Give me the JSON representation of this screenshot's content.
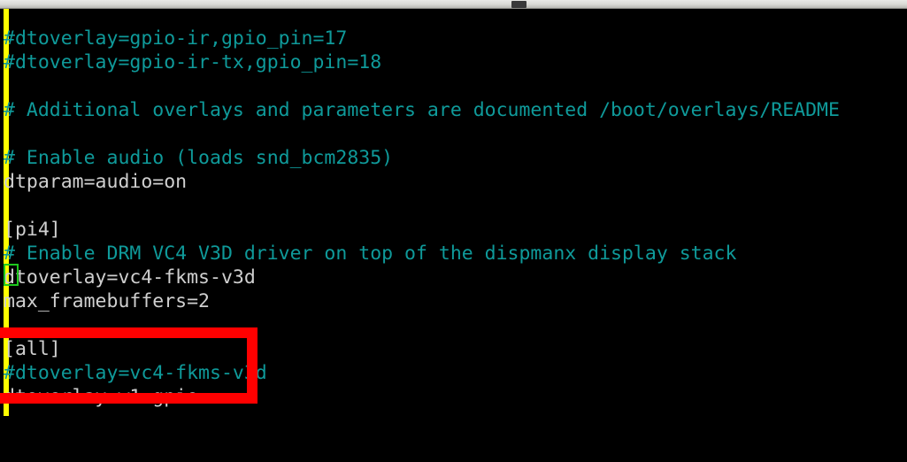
{
  "window": {
    "toolbar_present": true
  },
  "terminal": {
    "background_color": "#000000",
    "comment_color": "#0f9a9a",
    "text_color": "#cfcfcf",
    "left_marker_color": "#ffff00",
    "cursor_color": "#1ec81e",
    "cursor_line_index": 11,
    "lines": [
      {
        "text": "#dtoverlay=gpio-ir,gpio_pin=17",
        "type": "comment"
      },
      {
        "text": "#dtoverlay=gpio-ir-tx,gpio_pin=18",
        "type": "comment"
      },
      {
        "text": "",
        "type": "blank"
      },
      {
        "text": "# Additional overlays and parameters are documented /boot/overlays/README",
        "type": "comment"
      },
      {
        "text": "",
        "type": "blank"
      },
      {
        "text": "# Enable audio (loads snd_bcm2835)",
        "type": "comment"
      },
      {
        "text": "dtparam=audio=on",
        "type": "conf"
      },
      {
        "text": "",
        "type": "blank"
      },
      {
        "text": "[pi4]",
        "type": "conf"
      },
      {
        "text": "# Enable DRM VC4 V3D driver on top of the dispmanx display stack",
        "type": "comment"
      },
      {
        "text": "dtoverlay=vc4-fkms-v3d",
        "type": "conf"
      },
      {
        "text": "max_framebuffers=2",
        "type": "conf"
      },
      {
        "text": "",
        "type": "blank"
      },
      {
        "text": "[all]",
        "type": "conf"
      },
      {
        "text": "#dtoverlay=vc4-fkms-v3d",
        "type": "comment"
      },
      {
        "text": "dtoverlay=w1-gpio",
        "type": "conf"
      }
    ]
  },
  "annotation": {
    "shape": "rectangle",
    "color": "#ff0000",
    "stroke_width_px": 12,
    "highlights_lines": [
      "[all]",
      "#dtoverlay=vc4-fkms-v3d",
      "dtoverlay=w1-gpio"
    ]
  }
}
